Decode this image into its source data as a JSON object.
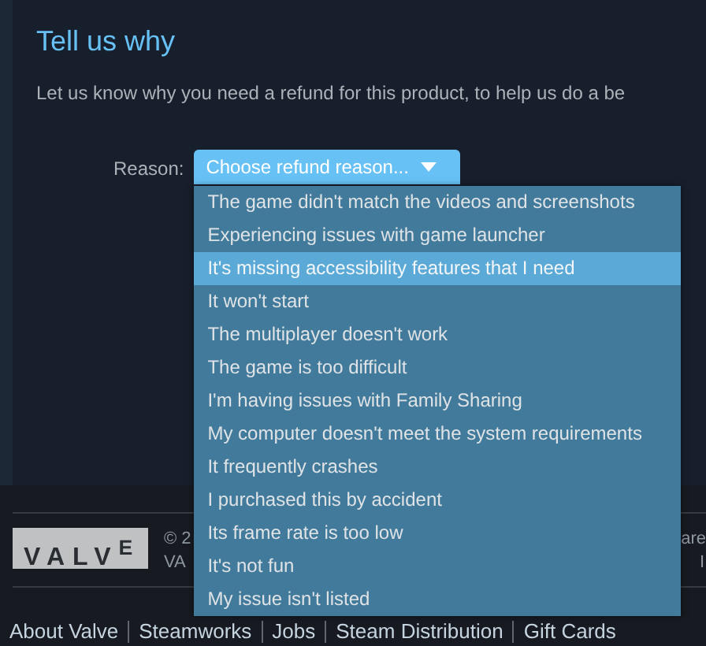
{
  "heading": "Tell us why",
  "description": "Let us know why you need a refund for this product, to help us do a be",
  "reason": {
    "label": "Reason:",
    "button": "Choose refund reason...",
    "expanded": true,
    "options": [
      {
        "label": "The game didn't match the videos and screenshots",
        "selected": false
      },
      {
        "label": "Experiencing issues with game launcher",
        "selected": false
      },
      {
        "label": "It's missing accessibility features that I need",
        "selected": true
      },
      {
        "label": "It won't start",
        "selected": false
      },
      {
        "label": "The multiplayer doesn't work",
        "selected": false
      },
      {
        "label": "The game is too difficult",
        "selected": false
      },
      {
        "label": "I'm having issues with Family Sharing",
        "selected": false
      },
      {
        "label": "My computer doesn't meet the system requirements",
        "selected": false
      },
      {
        "label": "It frequently crashes",
        "selected": false
      },
      {
        "label": "I purchased this by accident",
        "selected": false
      },
      {
        "label": "Its frame rate is too low",
        "selected": false
      },
      {
        "label": "It's not fun",
        "selected": false
      },
      {
        "label": "My issue isn't listed",
        "selected": false
      }
    ]
  },
  "footer": {
    "logo": "VALV$^{E}$",
    "copyright_lines": [
      "© 2",
      "VA"
    ],
    "right_fragments": [
      "are",
      "I"
    ],
    "links": [
      "About Valve",
      "Steamworks",
      "Jobs",
      "Steam Distribution",
      "Gift Cards"
    ]
  }
}
